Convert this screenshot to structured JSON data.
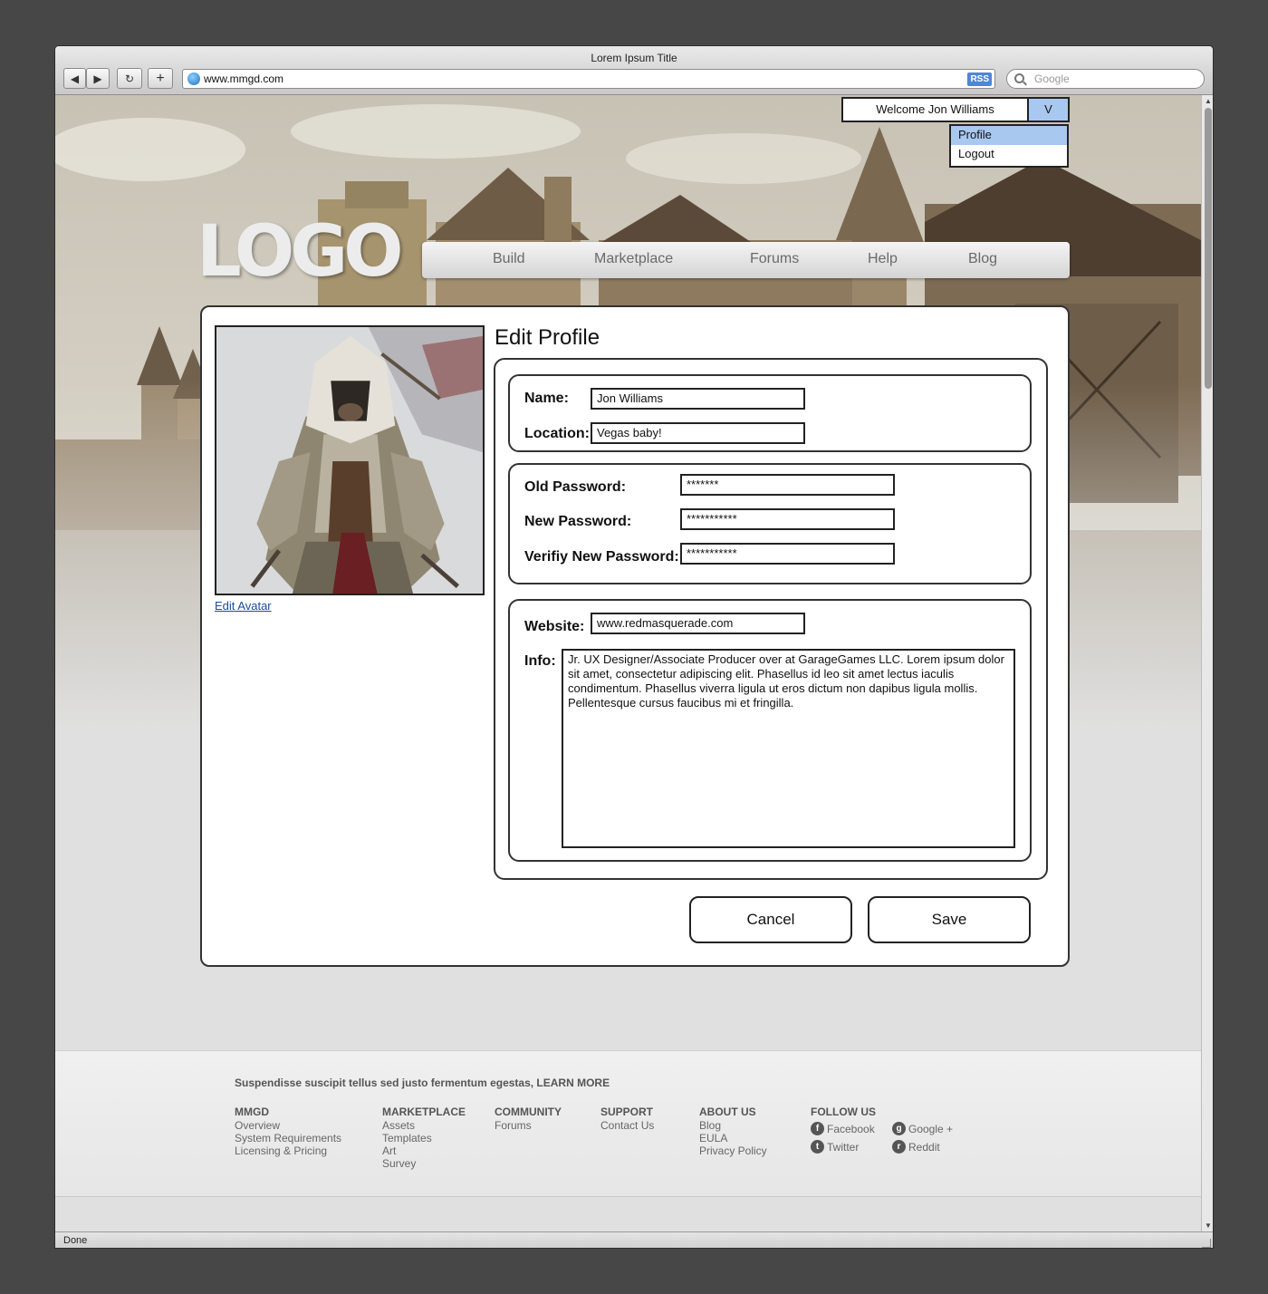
{
  "browser": {
    "title": "Lorem Ipsum Title",
    "url": "www.mmgd.com",
    "rss_label": "RSS",
    "search_placeholder": "Google",
    "status": "Done"
  },
  "user_menu": {
    "welcome": "Welcome Jon Williams",
    "toggle": "V",
    "items": [
      "Profile",
      "Logout"
    ]
  },
  "logo": "LOGO",
  "nav": [
    "Build",
    "Marketplace",
    "Forums",
    "Help",
    "Blog"
  ],
  "profile": {
    "title": "Edit Profile",
    "edit_avatar": "Edit Avatar",
    "name_label": "Name:",
    "name_value": "Jon Williams",
    "location_label": "Location:",
    "location_value": "Vegas baby!",
    "old_pw_label": "Old Password:",
    "old_pw_value": "*******",
    "new_pw_label": "New Password:",
    "new_pw_value": "***********",
    "verify_pw_label": "Verifiy New Password:",
    "verify_pw_value": "***********",
    "website_label": "Website:",
    "website_value": "www.redmasquerade.com",
    "info_label": "Info:",
    "info_value": "Jr. UX Designer/Associate Producer over at GarageGames LLC. Lorem ipsum dolor sit amet, consectetur adipiscing elit. Phasellus id leo sit amet lectus iaculis condimentum. Phasellus viverra ligula ut eros dictum non dapibus ligula mollis. Pellentesque cursus faucibus mi et fringilla.",
    "cancel": "Cancel",
    "save": "Save"
  },
  "footer": {
    "promo": "Suspendisse suscipit tellus sed justo fermentum egestas, LEARN MORE",
    "columns": [
      {
        "heading": "MMGD",
        "links": [
          "Overview",
          "System Requirements",
          "Licensing & Pricing"
        ]
      },
      {
        "heading": "MARKETPLACE",
        "links": [
          "Assets",
          "Templates",
          "Art",
          "Survey"
        ]
      },
      {
        "heading": "COMMUNITY",
        "links": [
          "Forums"
        ]
      },
      {
        "heading": "SUPPORT",
        "links": [
          "Contact Us"
        ]
      },
      {
        "heading": "ABOUT US",
        "links": [
          "Blog",
          "EULA",
          "Privacy Policy"
        ]
      }
    ],
    "follow_heading": "FOLLOW US",
    "social": [
      "Facebook",
      "Google +",
      "Twitter",
      "Reddit"
    ]
  }
}
